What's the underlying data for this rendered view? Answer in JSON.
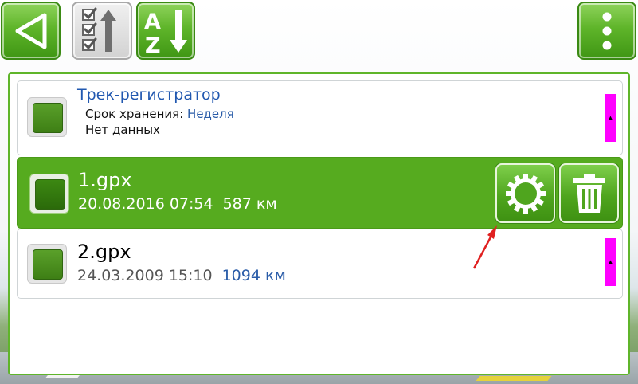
{
  "toolbar": {
    "back_icon": "triangle-left-icon",
    "sort_checked_icon": "checklist-up-arrow-icon",
    "sort_az_icon": "az-down-arrow-icon",
    "menu_icon": "vertical-dots-icon",
    "az_top": "A",
    "az_bottom": "Z"
  },
  "list": {
    "header_item": {
      "title": "Трек-регистратор",
      "retention_label": "Срок хранения:",
      "retention_value": "Неделя",
      "status": "Нет данных"
    },
    "items": [
      {
        "name": "1.gpx",
        "datetime": "20.08.2016 07:54",
        "distance": "587 км",
        "selected": true
      },
      {
        "name": "2.gpx",
        "datetime": "24.03.2009 15:10",
        "distance": "1094 км",
        "selected": false
      }
    ],
    "actions": {
      "settings_icon": "gear-icon",
      "delete_icon": "trash-icon"
    }
  },
  "colors": {
    "accent_green": "#56ab1f",
    "link_blue": "#2158b0",
    "scroll_marker": "#ff00ff",
    "annotation_arrow": "#e02020"
  }
}
